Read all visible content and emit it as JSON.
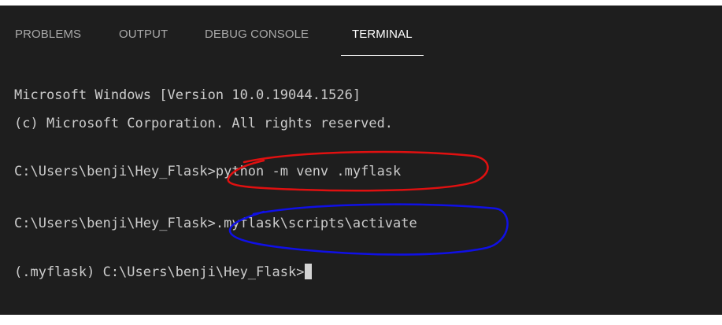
{
  "tabs": [
    {
      "label": "PROBLEMS",
      "active": false
    },
    {
      "label": "OUTPUT",
      "active": false
    },
    {
      "label": "DEBUG CONSOLE",
      "active": false
    },
    {
      "label": "TERMINAL",
      "active": true
    }
  ],
  "terminal": {
    "lines": [
      "Microsoft Windows [Version 10.0.19044.1526]",
      "(c) Microsoft Corporation. All rights reserved.",
      "C:\\Users\\benji\\Hey_Flask>python -m venv .myflask",
      "C:\\Users\\benji\\Hey_Flask>.myflask\\scripts\\activate",
      "(.myflask) C:\\Users\\benji\\Hey_Flask>"
    ]
  },
  "annotations": {
    "red_circle_color": "#e01010",
    "blue_circle_color": "#1010e6"
  },
  "colors": {
    "background": "#1e1e1e",
    "text": "#cccccc",
    "active_tab": "#ffffff",
    "inactive_tab": "#a9a9a9"
  }
}
